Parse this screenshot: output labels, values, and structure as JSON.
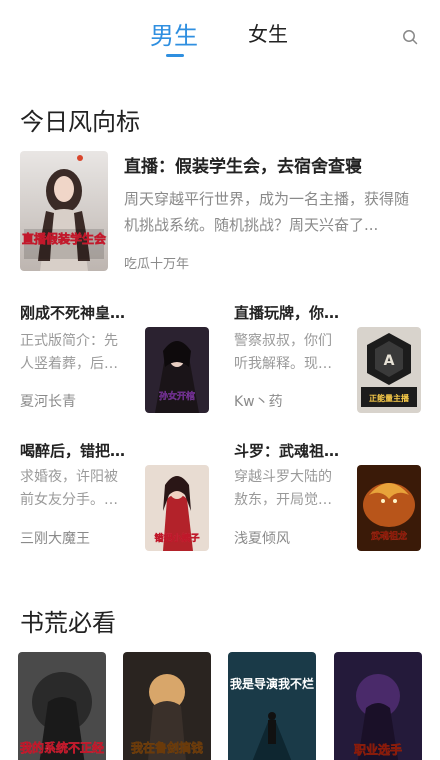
{
  "header": {
    "tab_male": "男生",
    "tab_female": "女生",
    "search_icon": "search-icon"
  },
  "section_today": {
    "title": "今日风向标",
    "featured": {
      "title": "直播：假装学生会，去宿舍查寝",
      "desc": "周天穿越平行世界，成为一名主播，获得随机挑战系统。随机挑战？周天兴奋了...",
      "author": "吃瓜十万年",
      "cover_text": "直播假装学生会"
    },
    "books": [
      {
        "title": "刚成不死神皇…",
        "desc": "正式版简介：先人竖着葬，后…",
        "author": "夏河长青",
        "cover_text": "孙女开棺"
      },
      {
        "title": "直播玩牌，你…",
        "desc": "警察叔叔，你们听我解释。现…",
        "author": "Kw丶药",
        "cover_text": "正能量主播"
      },
      {
        "title": "喝醉后，错把…",
        "desc": "求婚夜，许阳被前女友分手。…",
        "author": "三刚大魔王",
        "cover_text": "错把小姨子"
      },
      {
        "title": "斗罗：武魂祖…",
        "desc": "穿越斗罗大陆的敖东，开局觉…",
        "author": "浅夏倾风",
        "cover_text": "武魂祖龙"
      }
    ]
  },
  "section_must": {
    "title": "书荒必看",
    "books": [
      {
        "cover_text": "我的系统不正经"
      },
      {
        "cover_text": "我在鲁剑搞钱"
      },
      {
        "cover_text": "我是导演我不烂"
      },
      {
        "cover_text": "职业选手"
      }
    ]
  },
  "colors": {
    "accent": "#2f8fe0",
    "text_primary": "#222222",
    "text_secondary": "#8a8a8a"
  }
}
